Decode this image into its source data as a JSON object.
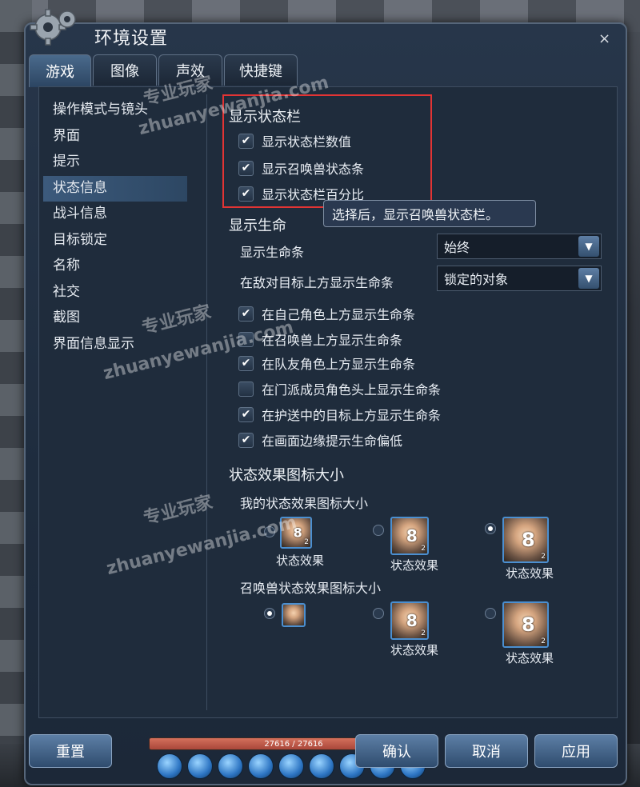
{
  "window": {
    "title": "环境设置",
    "close_glyph": "×"
  },
  "tabs": [
    {
      "label": "游戏"
    },
    {
      "label": "图像"
    },
    {
      "label": "声效"
    },
    {
      "label": "快捷键"
    }
  ],
  "sidebar": {
    "items": [
      {
        "label": "操作模式与镜头"
      },
      {
        "label": "界面"
      },
      {
        "label": "提示"
      },
      {
        "label": "状态信息"
      },
      {
        "label": "战斗信息"
      },
      {
        "label": "目标锁定"
      },
      {
        "label": "名称"
      },
      {
        "label": "社交"
      },
      {
        "label": "截图"
      },
      {
        "label": "界面信息显示"
      }
    ],
    "active_index": 3
  },
  "status_bar": {
    "title": "显示状态栏",
    "options": [
      {
        "label": "显示状态栏数值",
        "checked": true
      },
      {
        "label": "显示召唤兽状态条",
        "checked": true
      },
      {
        "label": "显示状态栏百分比",
        "checked": true
      }
    ],
    "tooltip": "选择后，显示召唤兽状态栏。"
  },
  "health": {
    "title": "显示生命",
    "show_bar_label": "显示生命条",
    "show_bar_value": "始终",
    "enemy_label": "在敌对目标上方显示生命条",
    "enemy_value": "锁定的对象",
    "options": [
      {
        "label": "在自己角色上方显示生命条",
        "checked": true
      },
      {
        "label": "在召唤兽上方显示生命条",
        "checked": false
      },
      {
        "label": "在队友角色上方显示生命条",
        "checked": true
      },
      {
        "label": "在门派成员角色头上显示生命条",
        "checked": false
      },
      {
        "label": "在护送中的目标上方显示生命条",
        "checked": true
      },
      {
        "label": "在画面边缘提示生命偏低",
        "checked": true
      }
    ]
  },
  "effects": {
    "title": "状态效果图标大小",
    "my_title": "我的状态效果图标大小",
    "summon_title": "召唤兽状态效果图标大小",
    "caption": "状态效果",
    "icon_number": "8",
    "icon_sub": "2",
    "my_selected_index": 2,
    "summon_selected_index": 0
  },
  "buttons": {
    "reset": "重置",
    "confirm": "确认",
    "cancel": "取消",
    "apply": "应用"
  },
  "hud": {
    "hp_text": "27616 / 27616"
  },
  "watermark": {
    "cn": "专业玩家",
    "en": "zhuanyewanjia.com"
  },
  "colors": {
    "highlight_box": "#e23434",
    "accent": "#4b8fd0"
  }
}
